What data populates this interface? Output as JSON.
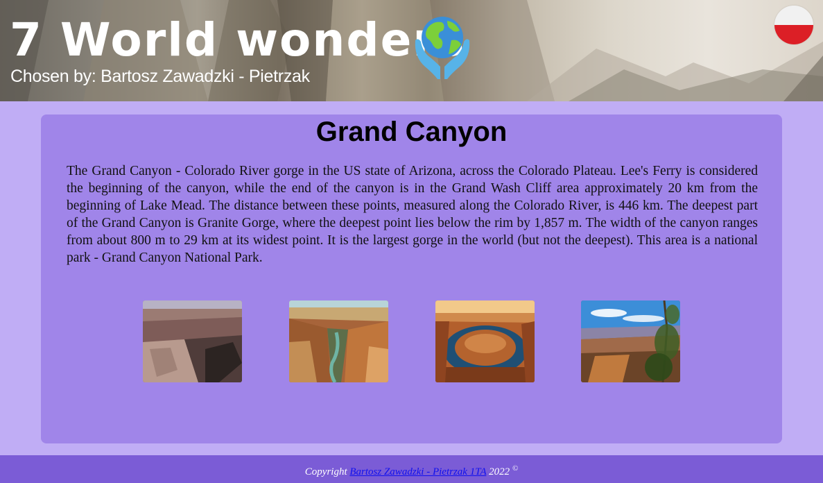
{
  "header": {
    "title": "7 World wonders",
    "subtitle": "Chosen by: Bartosz Zawadzki - Pietrzak",
    "language_flag": "poland-flag-icon",
    "globe_icon": "globe-in-hands-icon"
  },
  "main": {
    "heading": "Grand Canyon",
    "description": "The Grand Canyon - Colorado River gorge in the US state of Arizona, across the Colorado Plateau. Lee's Ferry is considered the beginning of the canyon, while the end of the canyon is in the Grand Wash Cliff area approximately 20 km from the beginning of Lake Mead. The distance between these points, measured along the Colorado River, is 446 km. The deepest part of the Grand Canyon is Granite Gorge, where the deepest point lies below the rim by 1,857 m. The width of the canyon ranges from about 800 m to 29 km at its widest point. It is the largest gorge in the world (but not the deepest). This area is a national park - Grand Canyon National Park.",
    "gallery": [
      "grand-canyon-photo-1",
      "grand-canyon-photo-2",
      "horseshoe-bend-photo",
      "grand-canyon-photo-4"
    ]
  },
  "footer": {
    "prefix": "Copyright",
    "author_link": "Bartosz Zawadzki - Pietrzak 1TA",
    "year": "2022",
    "symbol": "©"
  },
  "colors": {
    "page_bg": "#c0adf5",
    "card_bg": "#a085e9",
    "footer_bg": "#7b5cd6",
    "link": "#1010ee",
    "flag_red": "#dc1f26"
  }
}
